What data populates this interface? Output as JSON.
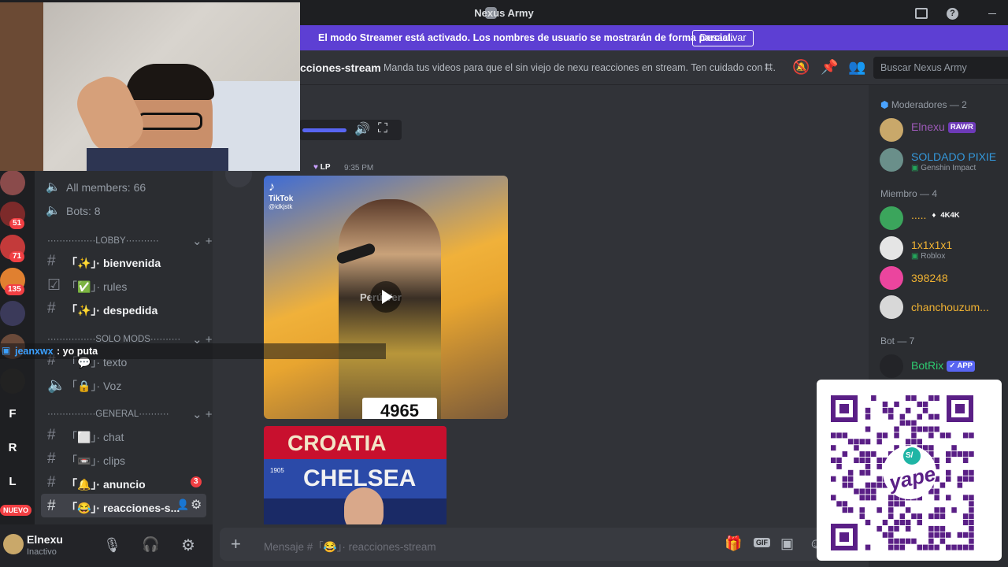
{
  "window": {
    "title": "Nexus Army"
  },
  "streamer_banner": {
    "message": "El modo Streamer está activado. Los nombres de usuario se mostrarán de forma parcial.",
    "button": "Desactivar"
  },
  "rail": {
    "servers": [
      {
        "label": "",
        "badge": ""
      },
      {
        "label": "",
        "badge": "51"
      },
      {
        "label": "",
        "badge": "71"
      },
      {
        "label": "",
        "badge": "135"
      },
      {
        "label": "",
        "badge": ""
      },
      {
        "label": "",
        "badge": ""
      },
      {
        "label": "",
        "badge": ""
      },
      {
        "label": "F",
        "badge": ""
      },
      {
        "label": "R",
        "badge": ""
      },
      {
        "label": "L",
        "badge": ""
      },
      {
        "label": "",
        "badge": "NUEVO"
      }
    ]
  },
  "sidebar": {
    "stats": [
      {
        "label": "All members: 66"
      },
      {
        "label": "Bots: 8"
      }
    ],
    "categories": [
      {
        "label": "················LOBBY···········"
      },
      {
        "label": "················SOLO MODS··········"
      },
      {
        "label": "················GENERAL··········"
      }
    ],
    "channels": [
      {
        "name": "「✨」· bienvenida",
        "bold": true
      },
      {
        "name": "「✅」· rules",
        "bold": false
      },
      {
        "name": "「✨」· despedida",
        "bold": true
      },
      {
        "name": "「💬」· texto",
        "bold": false
      },
      {
        "name": "「🔒」· Voz",
        "bold": false
      },
      {
        "name": "「⬜」· chat",
        "bold": false
      },
      {
        "name": "「📼」· clips",
        "bold": false
      },
      {
        "name": "「🔔」· anuncio",
        "bold": true,
        "badge": "3"
      },
      {
        "name": "「😂」· reacciones-s...",
        "bold": true
      }
    ]
  },
  "overlay_chat": {
    "user": "jeanxwx",
    "text": ": yo puta"
  },
  "user": {
    "name": "Elnexu",
    "status": "Inactivo"
  },
  "channel_header": {
    "name": "cciones-stream",
    "topic": "Manda tus videos para que el sin viejo de nexu reacciones en stream. Ten cuidado con l...",
    "search_placeholder": "Buscar Nexus Army"
  },
  "message": {
    "role_tag": "LP",
    "time": "9:35 PM",
    "video_text": "Perú Ver",
    "tiktok_label": "TikTok",
    "tiktok_user": "@idkjstk",
    "number": "4965",
    "banner_text": "CROATIA",
    "banner_text2": "CHELSEA",
    "year": "1905"
  },
  "composer": {
    "placeholder": "Mensaje #「😂」· reacciones-stream"
  },
  "members": {
    "groups": [
      {
        "header": "Moderadores — 2",
        "items": [
          {
            "name": "Elnexu",
            "tag": "RAWR",
            "status": "",
            "color": "#9b59b6"
          },
          {
            "name": "SOLDADO PIXIE",
            "tag": "",
            "status": "Genshin Impact",
            "color": "#3498db"
          }
        ]
      },
      {
        "header": "Miembro — 4",
        "items": [
          {
            "name": ".....",
            "tag": "4K4K",
            "status": "",
            "color": "#f0b232"
          },
          {
            "name": "1x1x1x1",
            "tag": "",
            "status": "Roblox",
            "color": "#f0b232"
          },
          {
            "name": "398248",
            "tag": "",
            "status": "",
            "color": "#f0b232"
          },
          {
            "name": "chanchouzum...",
            "tag": "",
            "status": "",
            "color": "#f0b232"
          }
        ]
      },
      {
        "header": "Bot — 7",
        "items": [
          {
            "name": "BotRix",
            "tag": "APP",
            "status": "",
            "color": "#2ecc71"
          }
        ]
      }
    ]
  },
  "qr": {
    "brand": "yape",
    "symbol": "S/"
  },
  "colors": {
    "accent": "#5865f2",
    "streamer": "#5d3fd3",
    "alert": "#f23f43"
  }
}
